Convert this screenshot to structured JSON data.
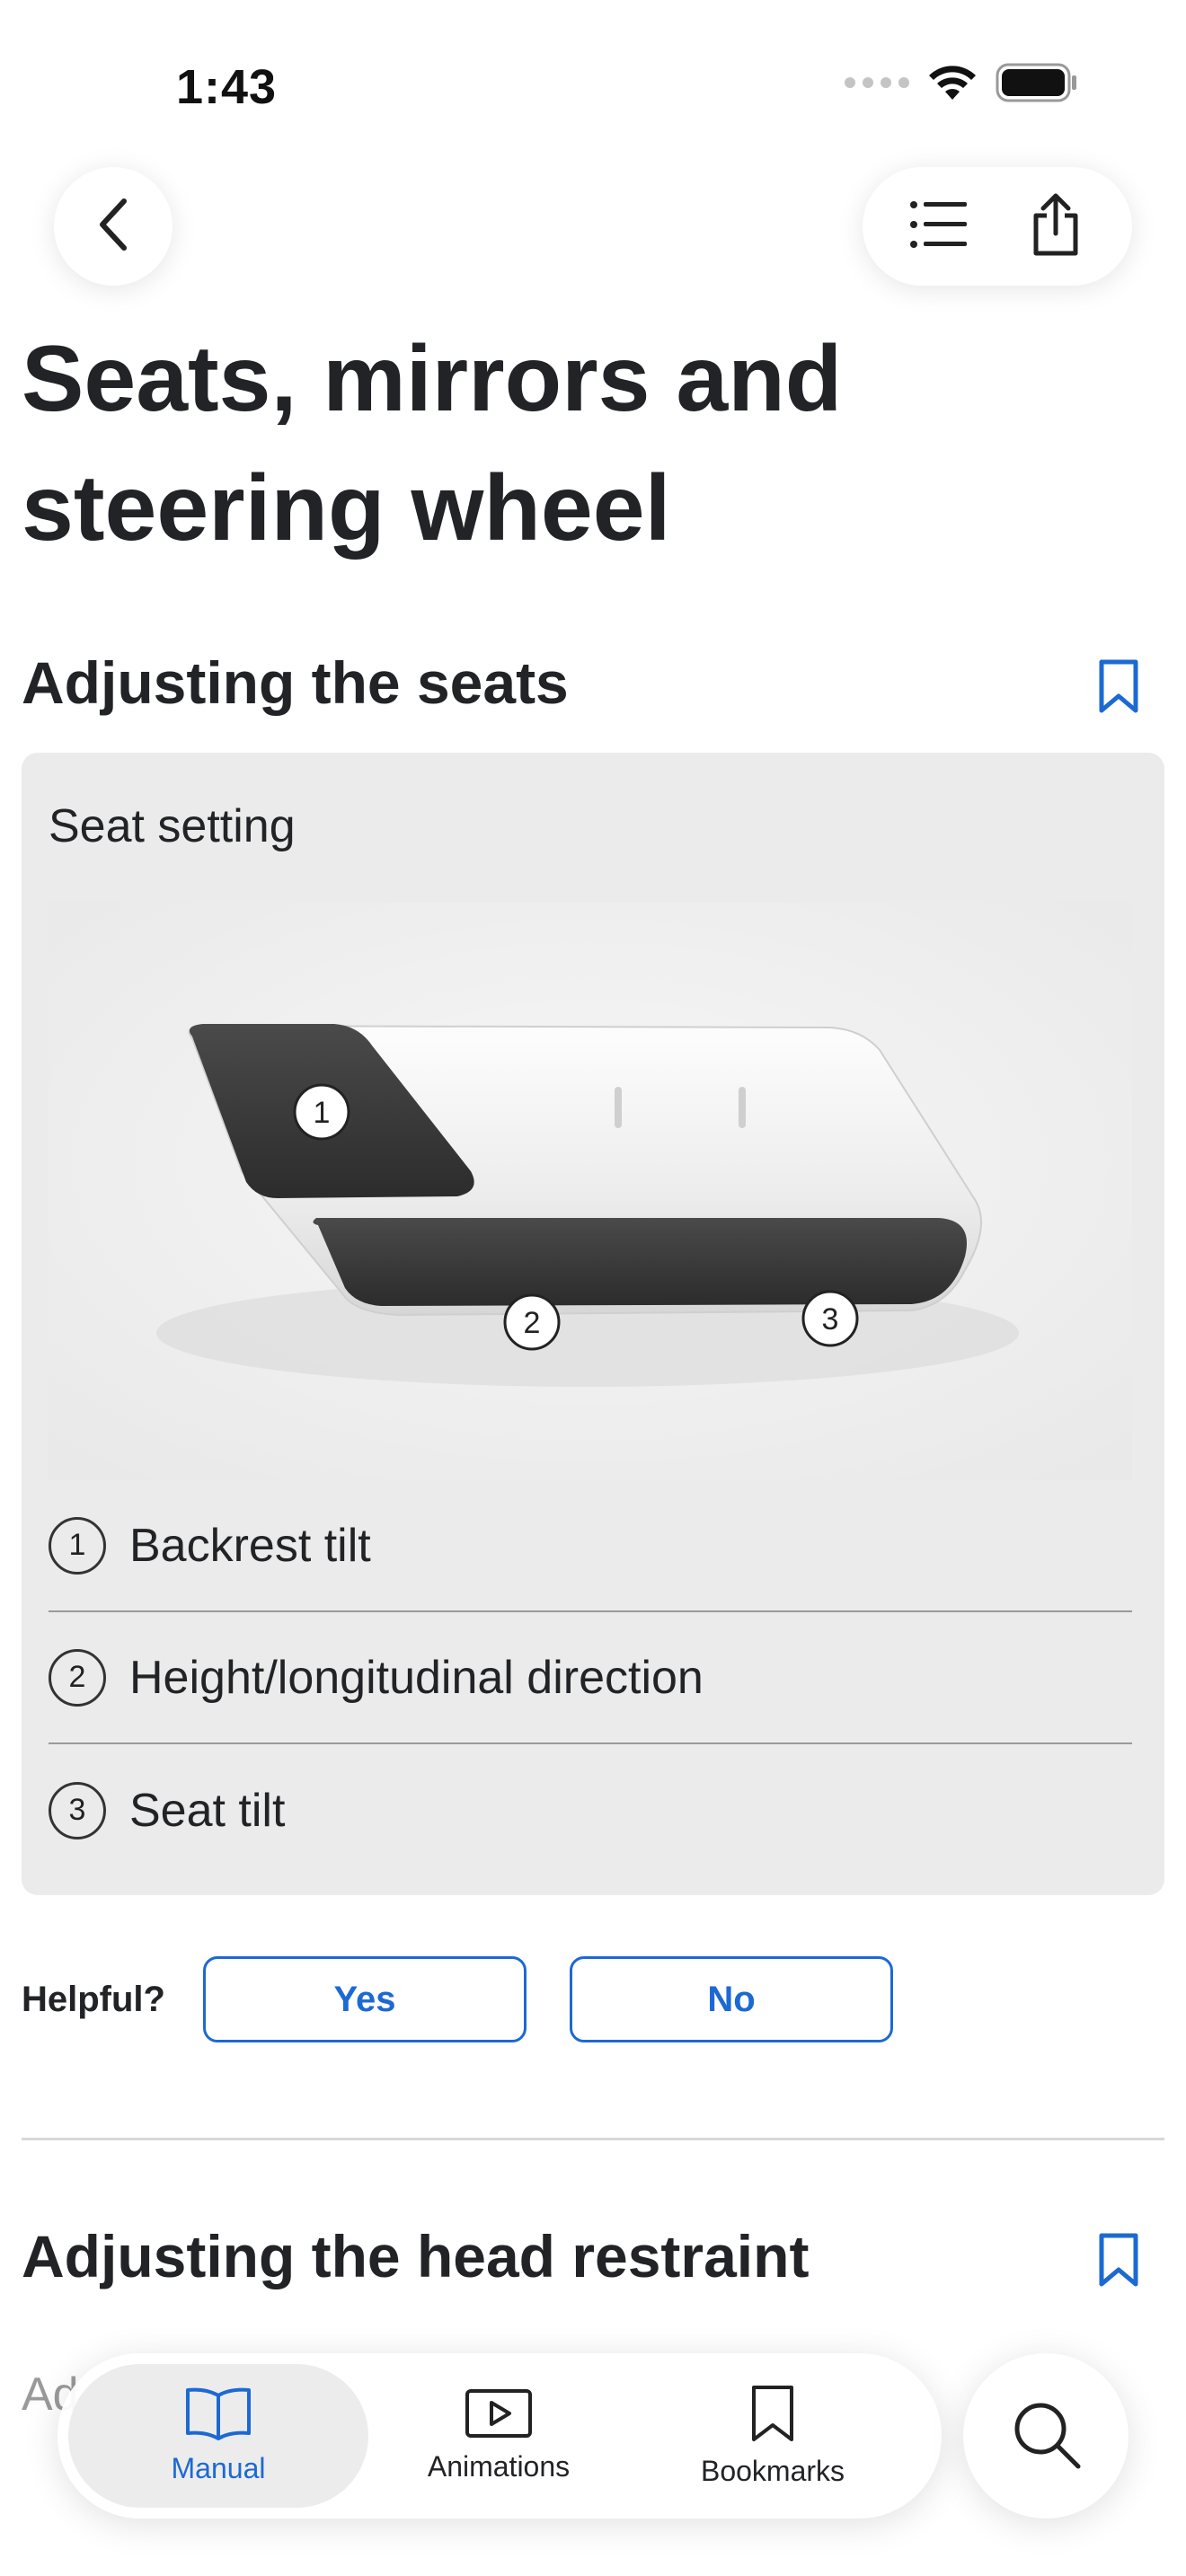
{
  "status_bar": {
    "time": "1:43"
  },
  "page": {
    "title": "Seats, mirrors and steering wheel"
  },
  "section1": {
    "title": "Adjusting the seats",
    "card_title": "Seat setting",
    "figure_markers": [
      "1",
      "2",
      "3"
    ],
    "legend": [
      {
        "num": "1",
        "label": "Backrest tilt"
      },
      {
        "num": "2",
        "label": "Height/longitudinal direction"
      },
      {
        "num": "3",
        "label": "Seat tilt"
      }
    ]
  },
  "feedback": {
    "label": "Helpful?",
    "yes": "Yes",
    "no": "No"
  },
  "section2": {
    "title": "Adjusting the head restraint",
    "partial_text": "Ad"
  },
  "tabbar": {
    "tabs": [
      {
        "label": "Manual",
        "icon": "book-icon",
        "active": true
      },
      {
        "label": "Animations",
        "icon": "play-icon",
        "active": false
      },
      {
        "label": "Bookmarks",
        "icon": "bookmark-icon",
        "active": false
      }
    ],
    "search_icon": "search-icon"
  },
  "colors": {
    "accent": "#1c69d4",
    "card_bg": "#ebebeb",
    "text": "#222326"
  }
}
